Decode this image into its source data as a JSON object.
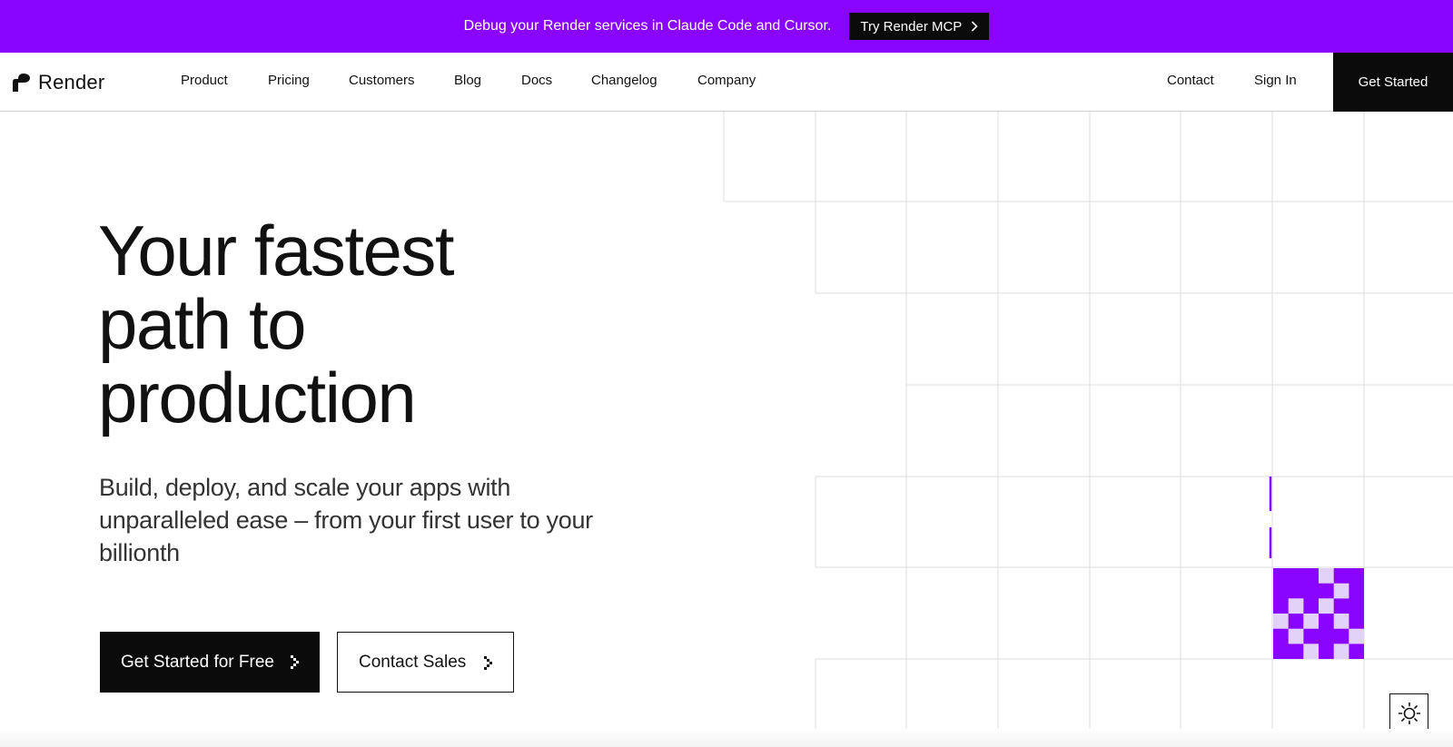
{
  "banner": {
    "text": "Debug your Render services in Claude Code and Cursor.",
    "button_label": "Try Render MCP"
  },
  "nav": {
    "logo_text": "Render",
    "items": [
      "Product",
      "Pricing",
      "Customers",
      "Blog",
      "Docs",
      "Changelog",
      "Company"
    ],
    "contact": "Contact",
    "sign_in": "Sign In",
    "get_started": "Get Started"
  },
  "hero": {
    "title_lines": [
      "Your fastest",
      "path to",
      "production"
    ],
    "subtitle": "Build, deploy, and scale your apps with unparalleled ease – from your first user to your billionth",
    "primary_cta": "Get Started for Free",
    "secondary_cta": "Contact Sales"
  },
  "colors": {
    "brand_purple": "#8A05FF",
    "light_purple": "#E3D2F8",
    "black": "#0B0B0B"
  },
  "icons": {
    "theme_toggle": "sun-icon",
    "cta_arrow": "chevron-right-icon"
  }
}
